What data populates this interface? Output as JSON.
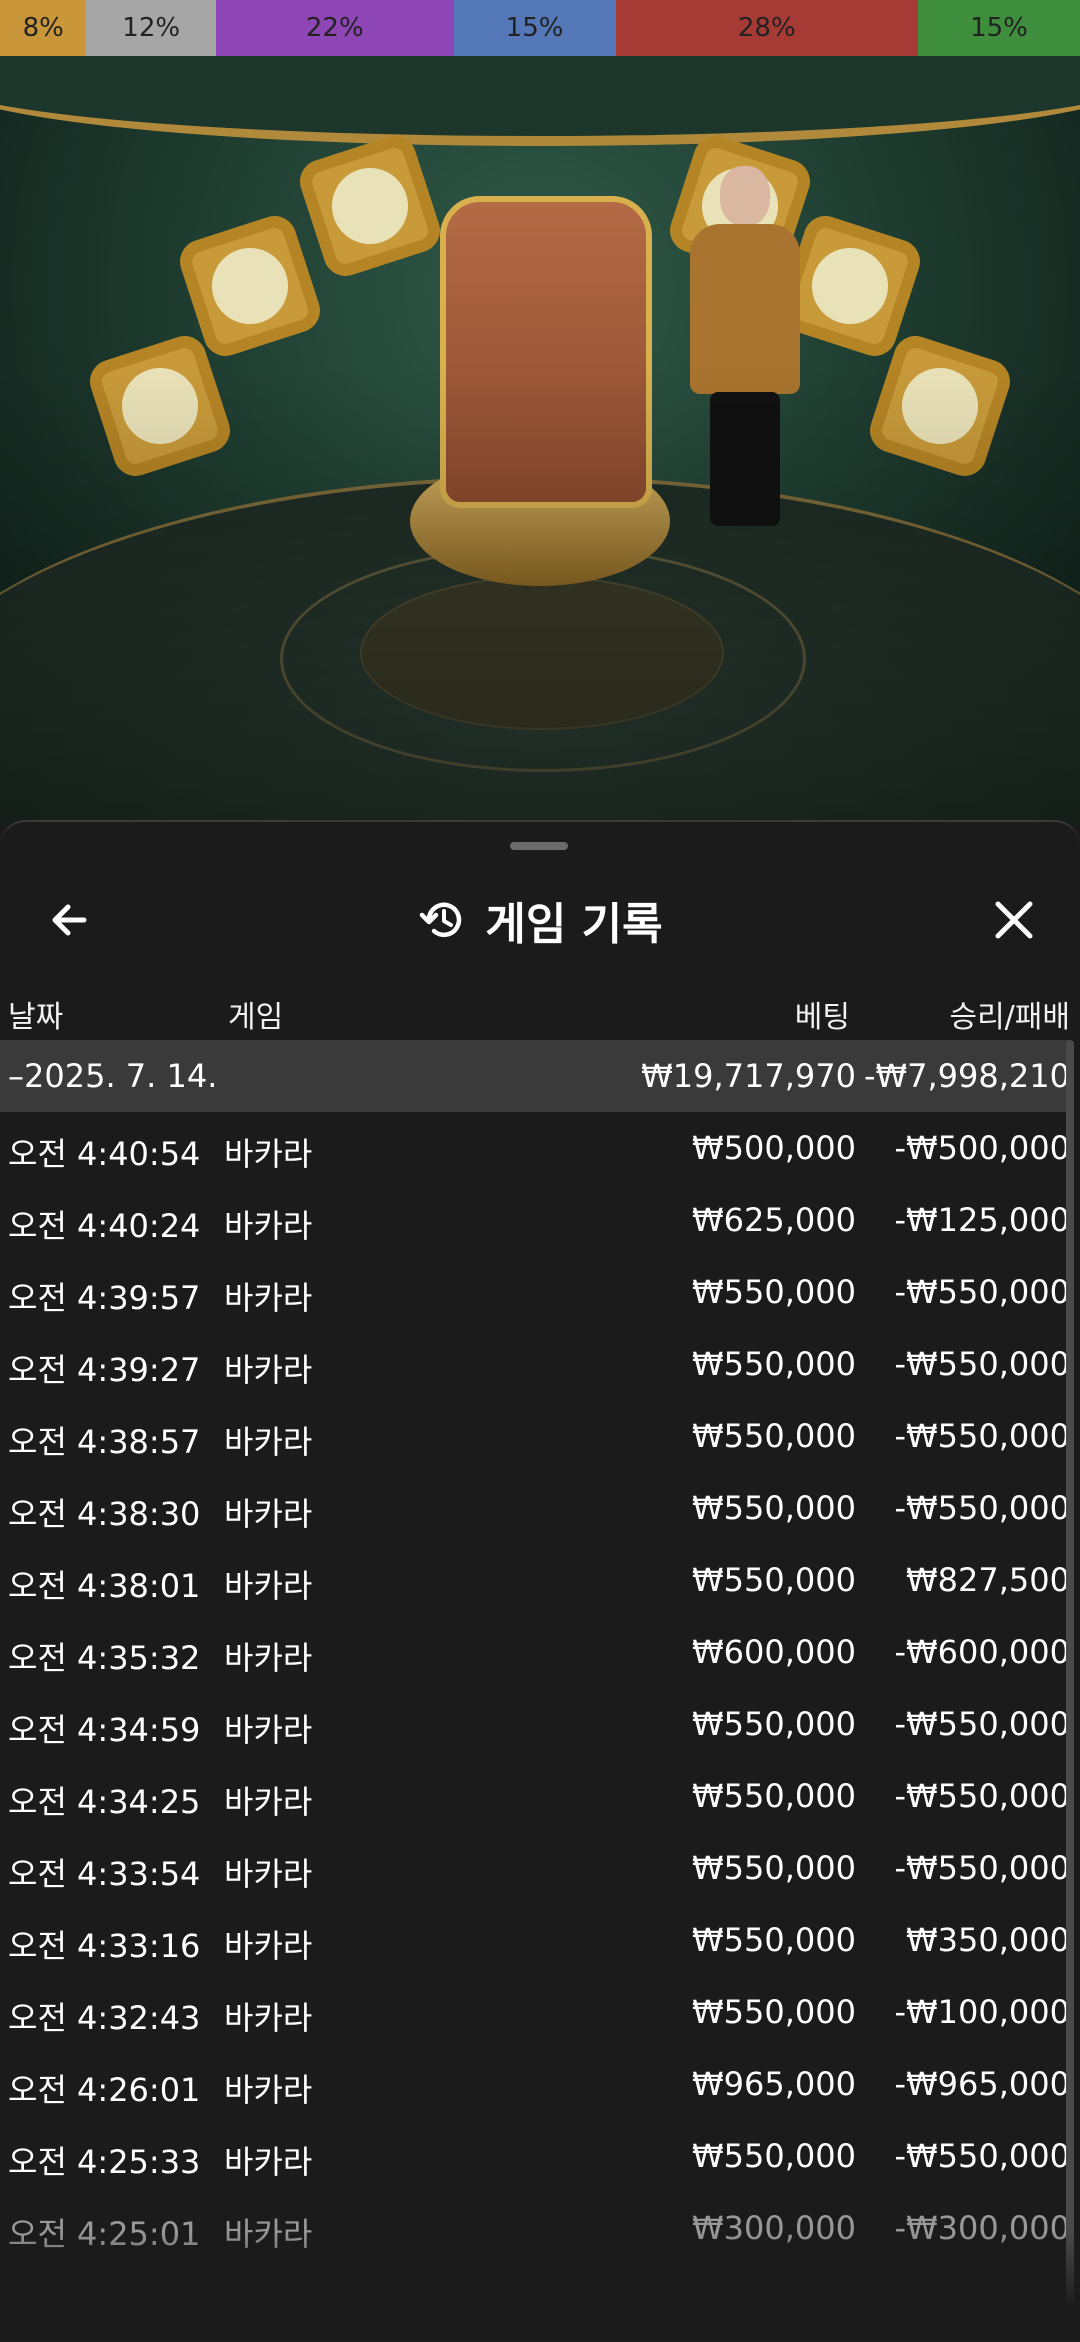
{
  "percent_bar": [
    {
      "label": "8%",
      "value": 8,
      "color": "#c9973a"
    },
    {
      "label": "12%",
      "value": 12,
      "color": "#a6a6a6"
    },
    {
      "label": "22%",
      "value": 22,
      "color": "#8e45b5"
    },
    {
      "label": "15%",
      "value": 15,
      "color": "#5477b8"
    },
    {
      "label": "28%",
      "value": 28,
      "color": "#a63a35"
    },
    {
      "label": "15%",
      "value": 15,
      "color": "#3f8e3e"
    }
  ],
  "header": {
    "title": "게임 기록",
    "back_icon": "arrow-left-icon",
    "history_icon": "history-icon",
    "close_icon": "close-icon"
  },
  "columns": {
    "date": "날짜",
    "game": "게임",
    "bet": "베팅",
    "win_loss": "승리/패배"
  },
  "summary": {
    "date": "–2025. 7. 14.",
    "bet": "₩19,717,970",
    "win_loss": "-₩7,998,210"
  },
  "rows": [
    {
      "time": "오전 4:40:54",
      "game": "바카라",
      "bet": "₩500,000",
      "win_loss": "-₩500,000"
    },
    {
      "time": "오전 4:40:24",
      "game": "바카라",
      "bet": "₩625,000",
      "win_loss": "-₩125,000"
    },
    {
      "time": "오전 4:39:57",
      "game": "바카라",
      "bet": "₩550,000",
      "win_loss": "-₩550,000"
    },
    {
      "time": "오전 4:39:27",
      "game": "바카라",
      "bet": "₩550,000",
      "win_loss": "-₩550,000"
    },
    {
      "time": "오전 4:38:57",
      "game": "바카라",
      "bet": "₩550,000",
      "win_loss": "-₩550,000"
    },
    {
      "time": "오전 4:38:30",
      "game": "바카라",
      "bet": "₩550,000",
      "win_loss": "-₩550,000"
    },
    {
      "time": "오전 4:38:01",
      "game": "바카라",
      "bet": "₩550,000",
      "win_loss": "₩827,500"
    },
    {
      "time": "오전 4:35:32",
      "game": "바카라",
      "bet": "₩600,000",
      "win_loss": "-₩600,000"
    },
    {
      "time": "오전 4:34:59",
      "game": "바카라",
      "bet": "₩550,000",
      "win_loss": "-₩550,000"
    },
    {
      "time": "오전 4:34:25",
      "game": "바카라",
      "bet": "₩550,000",
      "win_loss": "-₩550,000"
    },
    {
      "time": "오전 4:33:54",
      "game": "바카라",
      "bet": "₩550,000",
      "win_loss": "-₩550,000"
    },
    {
      "time": "오전 4:33:16",
      "game": "바카라",
      "bet": "₩550,000",
      "win_loss": "₩350,000"
    },
    {
      "time": "오전 4:32:43",
      "game": "바카라",
      "bet": "₩550,000",
      "win_loss": "-₩100,000"
    },
    {
      "time": "오전 4:26:01",
      "game": "바카라",
      "bet": "₩965,000",
      "win_loss": "-₩965,000"
    },
    {
      "time": "오전 4:25:33",
      "game": "바카라",
      "bet": "₩550,000",
      "win_loss": "-₩550,000"
    },
    {
      "time": "오전 4:25:01",
      "game": "바카라",
      "bet": "₩300,000",
      "win_loss": "-₩300,000"
    }
  ]
}
